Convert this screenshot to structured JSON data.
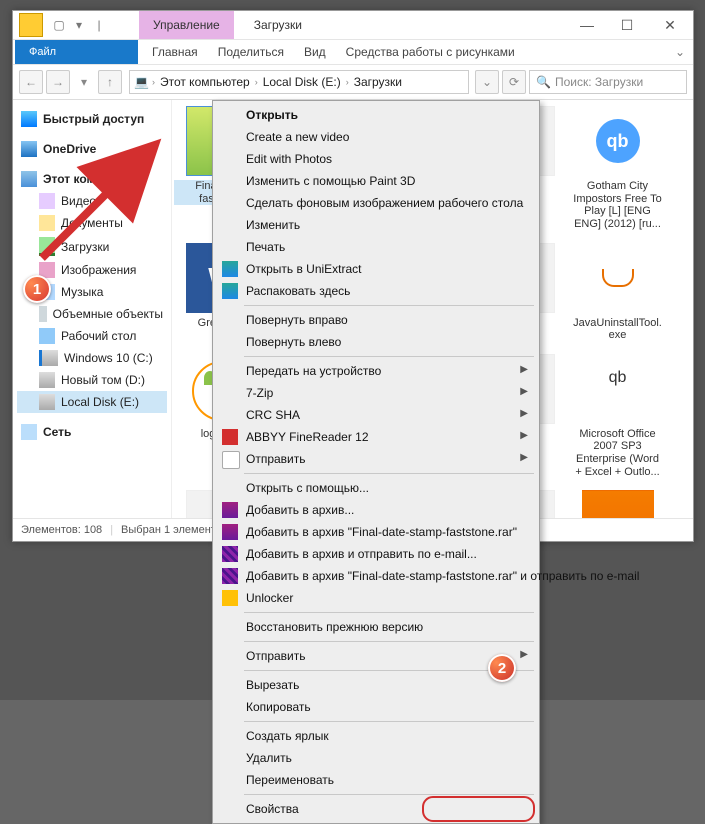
{
  "window": {
    "ribbon_tab_manage": "Управление",
    "title": "Загрузки",
    "menu_file": "Файл",
    "menu_home": "Главная",
    "menu_share": "Поделиться",
    "menu_view": "Вид",
    "menu_pictools": "Средства работы с рисунками"
  },
  "nav": {
    "root": "Этот компьютер",
    "disk": "Local Disk (E:)",
    "folder": "Загрузки",
    "search_placeholder": "Поиск: Загрузки"
  },
  "sidebar": {
    "quick": "Быстрый доступ",
    "onedrive": "OneDrive",
    "thispc": "Этот компьютер",
    "video": "Видео",
    "docs": "Документы",
    "downloads": "Загрузки",
    "images": "Изображения",
    "music": "Музыка",
    "objects": "Объемные объекты",
    "desktop": "Рабочий стол",
    "win10": "Windows 10 (C:)",
    "newvol": "Новый том (D:)",
    "local": "Local Disk (E:)",
    "network": "Сеть"
  },
  "files": {
    "f0": "Final-date-faststone",
    "f1": "Greetings",
    "f2": "logotype",
    "f3": "Gotham City Impostors Free To Play [L] [ENG ENG] (2012) [ru...",
    "f4": "JavaUninstallTool.exe",
    "f5": "Microsoft Office 2007 SP3 Enterprise (Word + Excel + Outlo..."
  },
  "ctx": {
    "open": "Открыть",
    "newvideo": "Create a new video",
    "editphotos": "Edit with Photos",
    "paint3d": "Изменить с помощью Paint 3D",
    "wallpaper": "Сделать фоновым изображением рабочего стола",
    "edit": "Изменить",
    "print": "Печать",
    "uniextract": "Открыть в UniExtract",
    "unpack": "Распаковать здесь",
    "rotr": "Повернуть вправо",
    "rotl": "Повернуть влево",
    "cast": "Передать на устройство",
    "sevenzip": "7-Zip",
    "crcsha": "CRC SHA",
    "abbyy": "ABBYY FineReader 12",
    "sendext": "Отправить",
    "openwith": "Открыть с помощью...",
    "addarch": "Добавить в архив...",
    "addrar": "Добавить в архив \"Final-date-stamp-faststone.rar\"",
    "addmail": "Добавить в архив и отправить по e-mail...",
    "addrarmail": "Добавить в архив \"Final-date-stamp-faststone.rar\" и отправить по e-mail",
    "unlocker": "Unlocker",
    "restore": "Восстановить прежнюю версию",
    "sendto": "Отправить",
    "cut": "Вырезать",
    "copy": "Копировать",
    "shortcut": "Создать ярлык",
    "delete": "Удалить",
    "rename": "Переименовать",
    "properties": "Свойства"
  },
  "status": {
    "elements": "Элементов: 108",
    "selected": "Выбран 1 элемент: 5"
  },
  "badges": {
    "b1": "1",
    "b2": "2"
  }
}
